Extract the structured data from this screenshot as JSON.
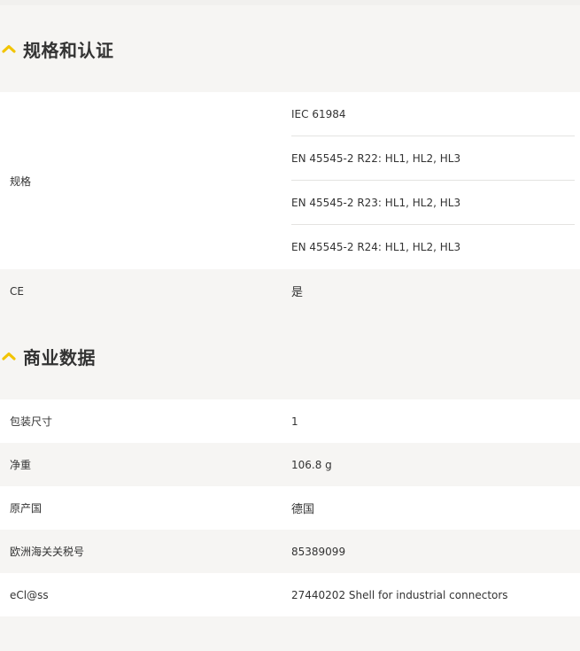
{
  "colors": {
    "accent": "#f2c400",
    "background": "#f6f5f3",
    "row_white": "#ffffff",
    "text": "#333333",
    "divider": "#e4e3e1"
  },
  "sections": [
    {
      "title": "规格和认证",
      "icon": "chevron-up-icon",
      "rows": [
        {
          "label": "规格",
          "values": [
            "IEC 61984",
            "EN 45545-2 R22: HL1, HL2, HL3",
            "EN 45545-2 R23: HL1, HL2, HL3",
            "EN 45545-2 R24: HL1, HL2, HL3"
          ]
        },
        {
          "label": "CE",
          "value": "是"
        }
      ]
    },
    {
      "title": "商业数据",
      "icon": "chevron-up-icon",
      "rows": [
        {
          "label": "包装尺寸",
          "value": "1"
        },
        {
          "label": "净重",
          "value": "106.8 g"
        },
        {
          "label": "原产国",
          "value": "德国"
        },
        {
          "label": "欧洲海关关税号",
          "value": "85389099"
        },
        {
          "label": "eCl@ss",
          "value": "27440202 Shell for industrial connectors"
        }
      ]
    }
  ]
}
